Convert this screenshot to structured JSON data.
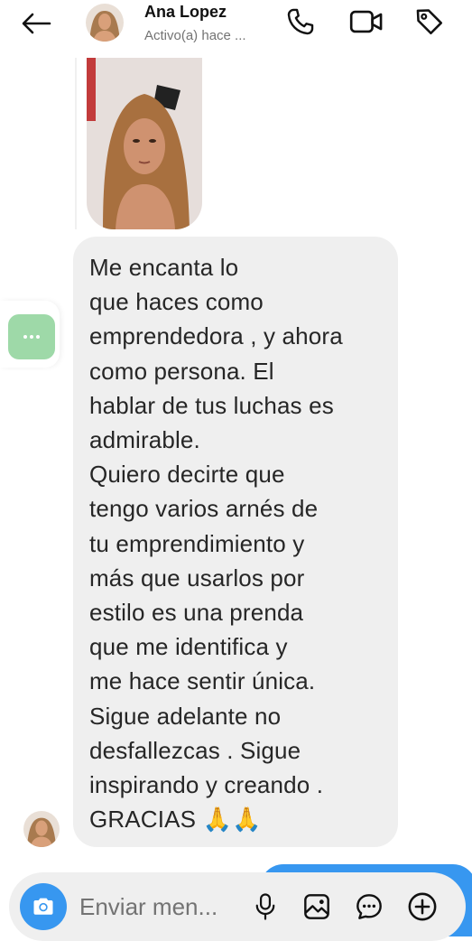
{
  "header": {
    "contact_name": "Ana Lopez",
    "status": "Activo(a) hace ...",
    "icons": [
      "back-arrow-icon",
      "phone-icon",
      "video-call-icon",
      "tag-icon"
    ]
  },
  "conversation": {
    "message_text": "Me encanta lo\nque haces como\nemprendedora , y ahora\ncomo persona. El\nhablar de tus luchas es\nadmirable.\nQuiero decirte que\ntengo varios arnés de\ntu emprendimiento y\nmás que usarlos por\nestilo es una prenda\nque me identifica y\nme hace sentir única.\nSigue adelante no\ndesfallezcas . Sigue\ninspirando y creando .\nGRACIAS 🙏🙏"
  },
  "composer": {
    "placeholder": "Enviar men...",
    "icons": [
      "camera-icon",
      "microphone-icon",
      "gallery-icon",
      "sticker-chat-icon",
      "plus-icon"
    ]
  },
  "colors": {
    "accent": "#3797f0",
    "bubble_bg": "#efefef",
    "more_button": "#9ed9a8"
  }
}
